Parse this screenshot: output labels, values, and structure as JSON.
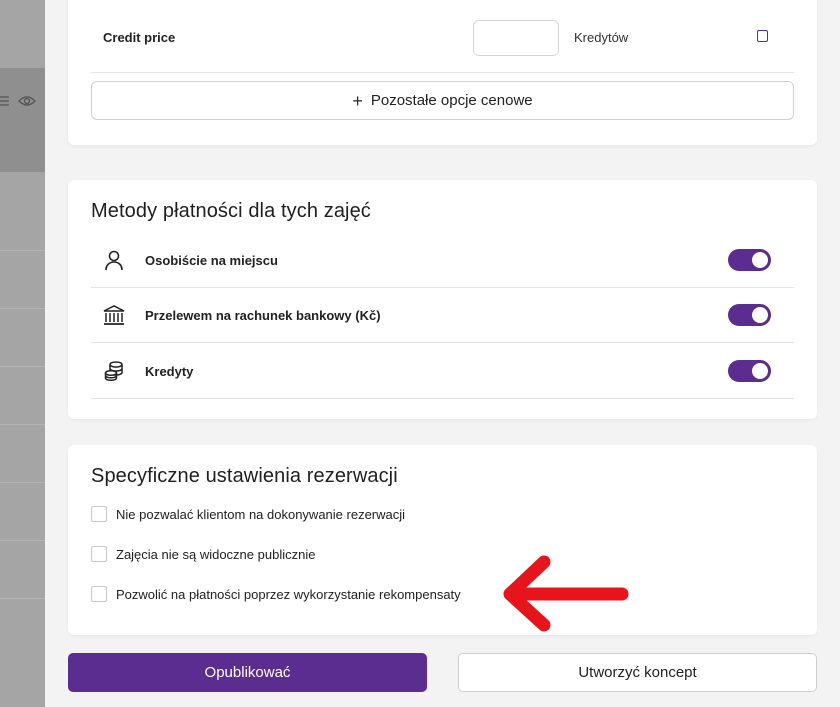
{
  "colors": {
    "accent": "#5b2d91",
    "annotation": "#e8141b"
  },
  "background": {
    "icons": [
      "menu-icon",
      "eye-icon"
    ]
  },
  "modal": {
    "close_icon": "close-icon"
  },
  "pricing": {
    "credit_label": "Credit price",
    "credit_unit": "Kredytów",
    "more_options_label": "Pozostałe opcje cenowe"
  },
  "payment_methods": {
    "title": "Metody płatności dla tych zajęć",
    "items": [
      {
        "label": "Osobiście na miejscu",
        "icon": "person-icon",
        "enabled": true
      },
      {
        "label": "Przelewem na rachunek bankowy (Kč)",
        "icon": "bank-icon",
        "enabled": true
      },
      {
        "label": "Kredyty",
        "icon": "coins-icon",
        "enabled": true
      }
    ]
  },
  "booking_settings": {
    "title": "Specyficzne ustawienia rezerwacji",
    "options": [
      {
        "label": "Nie pozwalać klientom na dokonywanie rezerwacji",
        "checked": false
      },
      {
        "label": "Zajęcia nie są widoczne publicznie",
        "checked": false
      },
      {
        "label": "Pozwolić na płatności poprzez wykorzystanie rekompensaty",
        "checked": false
      }
    ]
  },
  "footer": {
    "publish_label": "Opublikować",
    "draft_label": "Utworzyć koncept"
  }
}
